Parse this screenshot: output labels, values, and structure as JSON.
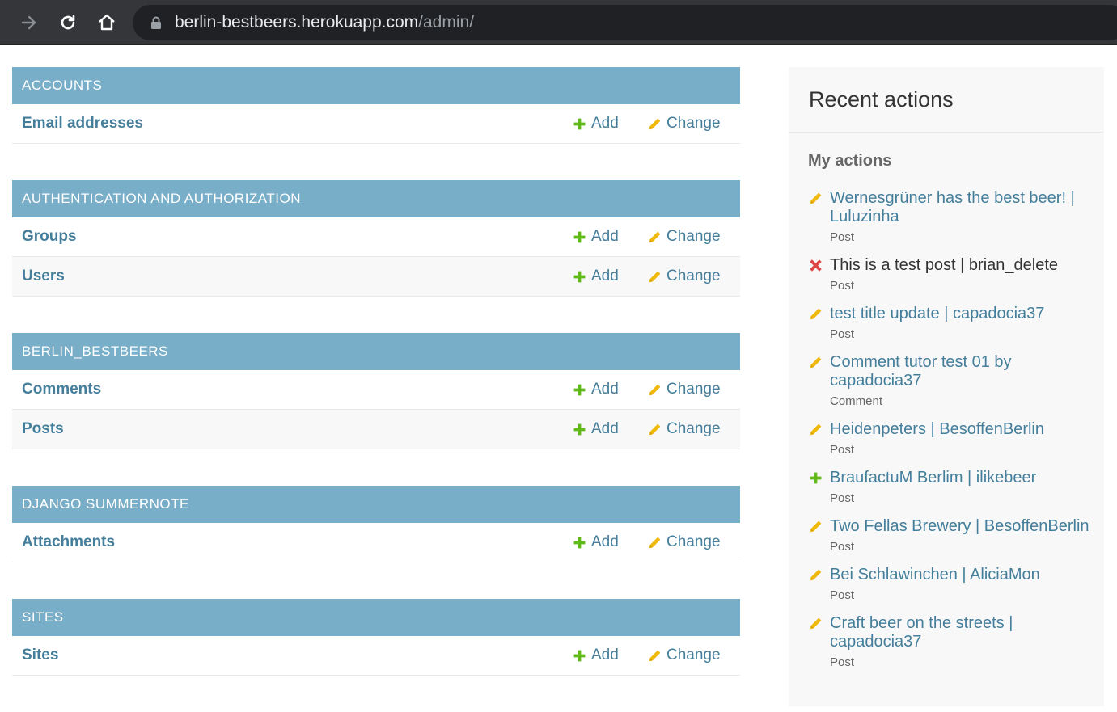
{
  "browser": {
    "url_host": "berlin-bestbeers.herokuapp.com",
    "url_path": "/admin/"
  },
  "colors": {
    "header_bg": "#79aec8",
    "link": "#447e9b",
    "add_green": "#5fb917",
    "change_yellow": "#efb80b",
    "delete_red": "#dd4646"
  },
  "modules": [
    {
      "title": "ACCOUNTS",
      "rows": [
        {
          "name": "Email addresses",
          "add": "Add",
          "change": "Change"
        }
      ]
    },
    {
      "title": "AUTHENTICATION AND AUTHORIZATION",
      "rows": [
        {
          "name": "Groups",
          "add": "Add",
          "change": "Change"
        },
        {
          "name": "Users",
          "add": "Add",
          "change": "Change"
        }
      ]
    },
    {
      "title": "BERLIN_BESTBEERS",
      "rows": [
        {
          "name": "Comments",
          "add": "Add",
          "change": "Change"
        },
        {
          "name": "Posts",
          "add": "Add",
          "change": "Change"
        }
      ]
    },
    {
      "title": "DJANGO SUMMERNOTE",
      "rows": [
        {
          "name": "Attachments",
          "add": "Add",
          "change": "Change"
        }
      ]
    },
    {
      "title": "SITES",
      "rows": [
        {
          "name": "Sites",
          "add": "Add",
          "change": "Change"
        }
      ]
    }
  ],
  "sidebar": {
    "title": "Recent actions",
    "subtitle": "My actions",
    "actions": [
      {
        "icon": "pencil-icon",
        "title": "Wernesgrüner has the best beer! | Luluzinha",
        "type": "Post",
        "deleted": false
      },
      {
        "icon": "x-icon",
        "title": "This is a test post | brian_delete",
        "type": "Post",
        "deleted": true
      },
      {
        "icon": "pencil-icon",
        "title": "test title update | capadocia37",
        "type": "Post",
        "deleted": false
      },
      {
        "icon": "pencil-icon",
        "title": "Comment tutor test 01 by capadocia37",
        "type": "Comment",
        "deleted": false
      },
      {
        "icon": "pencil-icon",
        "title": "Heidenpeters | BesoffenBerlin",
        "type": "Post",
        "deleted": false
      },
      {
        "icon": "plus-icon",
        "title": "BraufactuM Berlim | ilikebeer",
        "type": "Post",
        "deleted": false
      },
      {
        "icon": "pencil-icon",
        "title": "Two Fellas Brewery | BesoffenBerlin",
        "type": "Post",
        "deleted": false
      },
      {
        "icon": "pencil-icon",
        "title": "Bei Schlawinchen | AliciaMon",
        "type": "Post",
        "deleted": false
      },
      {
        "icon": "pencil-icon",
        "title": "Craft beer on the streets | capadocia37",
        "type": "Post",
        "deleted": false
      }
    ]
  }
}
